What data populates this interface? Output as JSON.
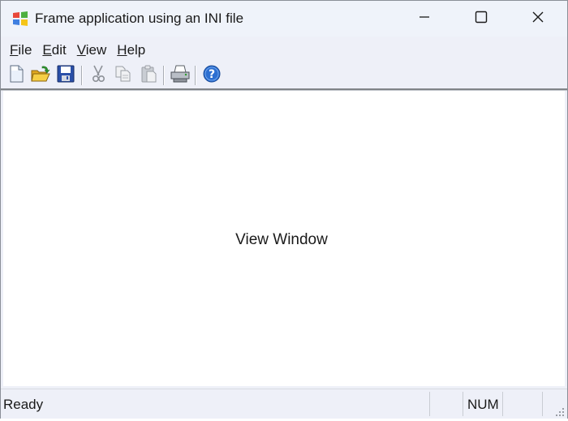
{
  "window": {
    "title": "Frame application using an INI file",
    "app_icon": "windows-logo-icon"
  },
  "caption_buttons": {
    "minimize": "minimize-icon",
    "maximize": "maximize-icon",
    "close": "close-icon"
  },
  "menu": {
    "items": [
      {
        "mnemonic": "F",
        "rest": "ile"
      },
      {
        "mnemonic": "E",
        "rest": "dit"
      },
      {
        "mnemonic": "V",
        "rest": "iew"
      },
      {
        "mnemonic": "H",
        "rest": "elp"
      }
    ]
  },
  "toolbar": {
    "buttons": [
      "new-file-icon",
      "open-folder-icon",
      "save-disk-icon",
      "cut-scissors-icon",
      "copy-icon",
      "paste-clipboard-icon",
      "print-icon",
      "help-icon"
    ],
    "disabled": [
      "cut-scissors-icon",
      "copy-icon",
      "paste-clipboard-icon"
    ]
  },
  "view": {
    "text": "View Window"
  },
  "status": {
    "text": "Ready",
    "panes": [
      "",
      "NUM",
      "",
      ""
    ]
  },
  "colors": {
    "help_blue": "#2c6fd1",
    "save_blue": "#2a4fa8",
    "folder_yellow": "#f0c030",
    "arrow_green": "#2f9a2f"
  }
}
